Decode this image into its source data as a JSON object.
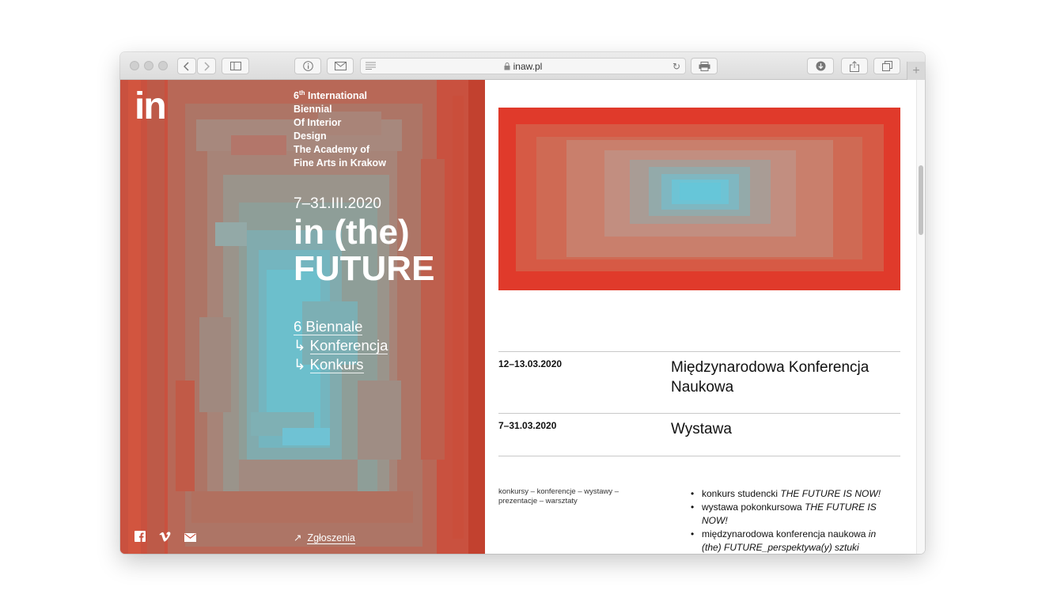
{
  "browser": {
    "url": "inaw.pl"
  },
  "sidebar": {
    "logo": "in",
    "info_lines": [
      "Biennial",
      "Of Interior",
      "Design",
      "The Academy of",
      "Fine Arts in Krakow"
    ],
    "info_ordinal_num": "6",
    "info_ordinal_sup": "th",
    "info_first_rest": " International",
    "dates": "7–31.III.2020",
    "title_line1": "in (the)",
    "title_line2": "FUTURE",
    "menu": [
      {
        "prefix": "",
        "label": "6 Biennale"
      },
      {
        "prefix": "↳ ",
        "label": "Konferencja"
      },
      {
        "prefix": "↳ ",
        "label": "Konkurs"
      }
    ],
    "apply_arrow": "↗",
    "apply_label": "Zgłoszenia",
    "social": [
      "facebook-icon",
      "vimeo-icon",
      "mail-icon"
    ]
  },
  "main": {
    "events": [
      {
        "date": "12–13.03.2020",
        "title": "Międzynarodowa Konferencja Naukowa"
      },
      {
        "date": "7–31.03.2020",
        "title": "Wystawa"
      }
    ],
    "tags": "konkursy –  konferencje –  wystawy –  prezentacje – warsztaty",
    "bullets": [
      {
        "text": "konkurs studencki ",
        "em": "THE FUTURE IS NOW!"
      },
      {
        "text": "wystawa pokonkursowa ",
        "em": "THE FUTURE IS NOW!"
      },
      {
        "text": "międzynarodowa konferencja naukowa ",
        "em": "in (the) FUTURE_perspektywa(y) sztuki"
      }
    ]
  },
  "colors": {
    "accent_red": "#e03a2b",
    "left_bg": "#c8503e",
    "cyan": "#6cc3d8"
  }
}
